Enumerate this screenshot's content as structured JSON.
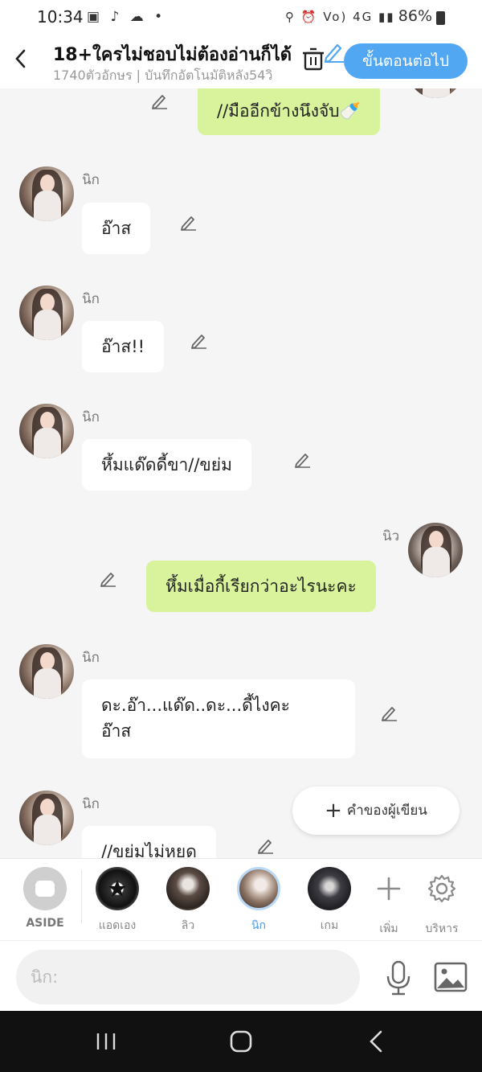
{
  "status": {
    "time": "10:34",
    "battery": "86%",
    "left_icons": "▣ ♪ ☁ •",
    "right_icons": "⚲ ⏰ Vo) 4G ▮▮"
  },
  "header": {
    "title": "18+ใครไม่ชอบไม่ต้องอ่านก็ได้",
    "subtitle": "1740ตัวอักษร | บันทึกอัตโนมัติหลัง54วิ",
    "next_label": "ขั้นตอนต่อไป"
  },
  "messages": [
    {
      "side": "right",
      "name": "",
      "text": "//มืออีกข้างนึงจับ🍼"
    },
    {
      "side": "left",
      "name": "นิก",
      "text": "อ๊าส"
    },
    {
      "side": "left",
      "name": "นิก",
      "text": "อ๊าส!!"
    },
    {
      "side": "left",
      "name": "นิก",
      "text": "หึ้มแด๊ดดี้ขา//ขย่ม"
    },
    {
      "side": "right",
      "name": "นิว",
      "text": "หึ้มเมื่อกี้เรียกว่าอะไรนะคะ"
    },
    {
      "side": "left",
      "name": "นิก",
      "text": "ดะ.อ๊า...แด๊ด..ดะ...ดี้ไงคะ\nอ๊าส"
    },
    {
      "side": "left",
      "name": "นิก",
      "text": "//ขย่มไม่หยุด"
    }
  ],
  "author_note": {
    "label": "คำของผู้เขียน"
  },
  "characters": [
    {
      "label": "ASIDE"
    },
    {
      "label": "แอดเอง"
    },
    {
      "label": "ลิว"
    },
    {
      "label": "นิก"
    },
    {
      "label": "เกม"
    },
    {
      "label": "เพิ่ม"
    },
    {
      "label": "บริหาร"
    }
  ],
  "input": {
    "placeholder": "นิก:"
  },
  "colors": {
    "accent": "#52a7f2",
    "my_bubble": "#d9f39c",
    "active_tab": "#4a9ae8"
  }
}
